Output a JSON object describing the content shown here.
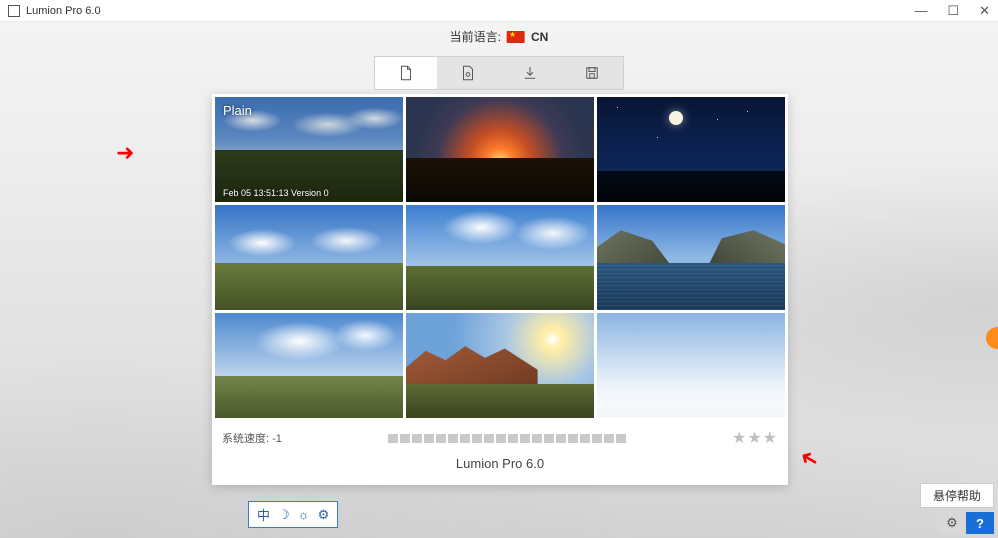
{
  "window": {
    "title": "Lumion Pro 6.0",
    "controls": {
      "min": "—",
      "max": "☐",
      "close": "✕"
    }
  },
  "language": {
    "label": "当前语言:",
    "code": "CN"
  },
  "tabs": [
    {
      "id": "new",
      "active": true
    },
    {
      "id": "open",
      "active": false
    },
    {
      "id": "import",
      "active": false
    },
    {
      "id": "save",
      "active": false
    }
  ],
  "scenes": [
    {
      "label": "Plain",
      "meta": "Feb 05 13:51:13 Version 0"
    },
    {
      "label": "",
      "meta": ""
    },
    {
      "label": "",
      "meta": ""
    },
    {
      "label": "",
      "meta": ""
    },
    {
      "label": "",
      "meta": ""
    },
    {
      "label": "",
      "meta": ""
    },
    {
      "label": "",
      "meta": ""
    },
    {
      "label": "",
      "meta": ""
    },
    {
      "label": "",
      "meta": ""
    }
  ],
  "footer": {
    "speed_label": "系统速度:",
    "speed_value": "-1",
    "product": "Lumion Pro 6.0",
    "stars": "★★★"
  },
  "theme_bar": {
    "items": [
      "中",
      "☽",
      "☼",
      "⚙"
    ]
  },
  "bottom_right": {
    "hover_help": "悬停帮助",
    "gear": "⚙",
    "help": "?"
  }
}
